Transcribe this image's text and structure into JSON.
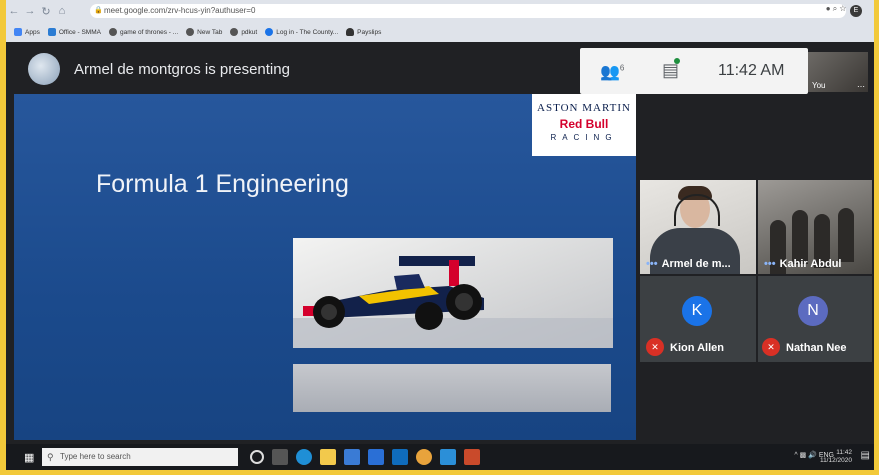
{
  "browser": {
    "url": "meet.google.com/zrv-hcus-yin?authuser=0",
    "bookmarks": [
      {
        "label": "Apps",
        "color": "#4285f4"
      },
      {
        "label": "Office - SMMA",
        "color": "#2b7cd3"
      },
      {
        "label": "game of thrones - ...",
        "color": "#555555"
      },
      {
        "label": "New Tab",
        "color": "#555555"
      },
      {
        "label": "pdkut",
        "color": "#555555"
      },
      {
        "label": "Log in - The County...",
        "color": "#1a73e8"
      },
      {
        "label": "Payslips",
        "color": "#333333"
      }
    ],
    "profile_initial": "E"
  },
  "meet": {
    "presenting_text": "Armel de montgros is presenting",
    "people_count": "6",
    "time": "11:42 AM",
    "self_label": "You"
  },
  "slide": {
    "brand_top": "ASTON MARTIN",
    "brand_mid": "Red Bull",
    "brand_bottom": "RACING",
    "title": "Formula 1 Engineering"
  },
  "participants": [
    {
      "name": "Armel de m...",
      "type": "video"
    },
    {
      "name": "Kahir Abdul",
      "type": "video"
    },
    {
      "name": "Kion Allen",
      "initial": "K",
      "color": "#1a73e8",
      "muted": true
    },
    {
      "name": "Nathan Nee",
      "initial": "N",
      "color": "#5c6bc0",
      "muted": true
    }
  ],
  "taskbar": {
    "search_placeholder": "Type here to search",
    "lang": "ENG",
    "clock_time": "11:42",
    "clock_date": "11/12/2020"
  }
}
